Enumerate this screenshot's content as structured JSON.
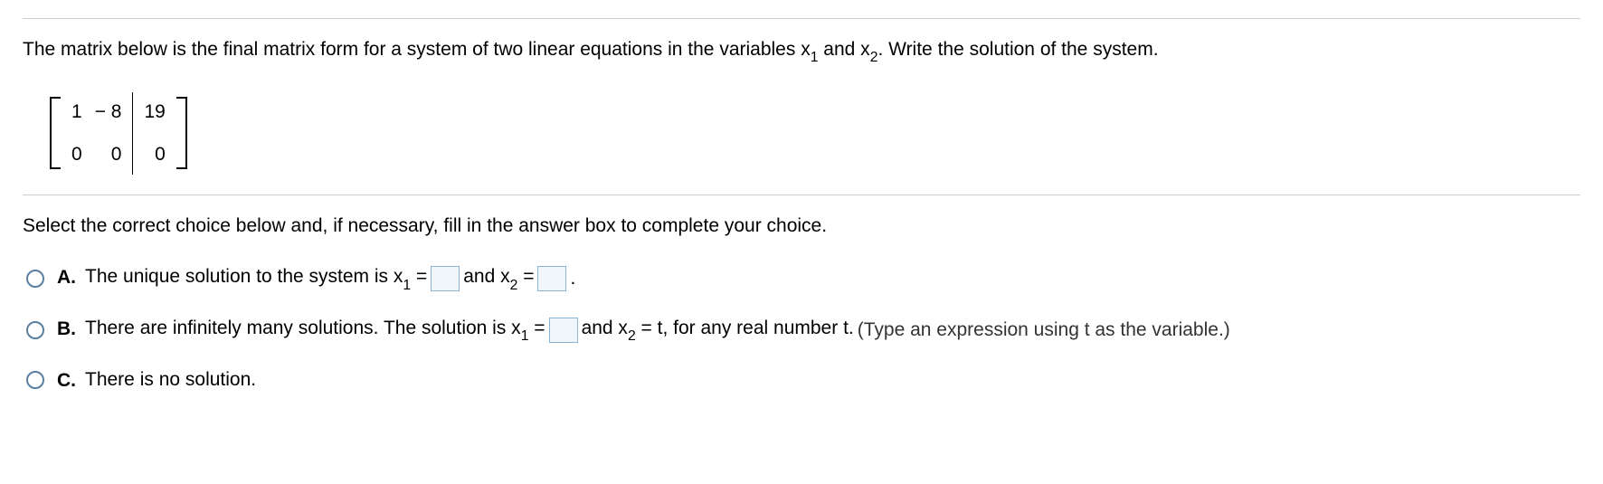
{
  "question": {
    "prompt_before": "The matrix below is the final matrix form for a system of two linear equations in the variables x",
    "sub1": "1",
    "prompt_mid": " and x",
    "sub2": "2",
    "prompt_after": ". Write the solution of the system."
  },
  "matrix": {
    "r1c1": "1",
    "r1c2": "− 8",
    "r1c3": "19",
    "r2c1": "0",
    "r2c2": "0",
    "r2c3": "0"
  },
  "instruction": "Select the correct choice below and, if necessary, fill in the answer box to complete your choice.",
  "options": {
    "a": {
      "letter": "A.",
      "t1": "The unique solution to the system is x",
      "s1": "1",
      "t2": " = ",
      "t3": " and x",
      "s2": "2",
      "t4": " = ",
      "t5": "."
    },
    "b": {
      "letter": "B.",
      "t1": "There are infinitely many solutions. The solution is x",
      "s1": "1",
      "t2": " = ",
      "t3": " and x",
      "s2": "2",
      "t4": " = t, for any real number t. ",
      "hint": "(Type an expression using t as the variable.)"
    },
    "c": {
      "letter": "C.",
      "t1": "There is no solution."
    }
  }
}
